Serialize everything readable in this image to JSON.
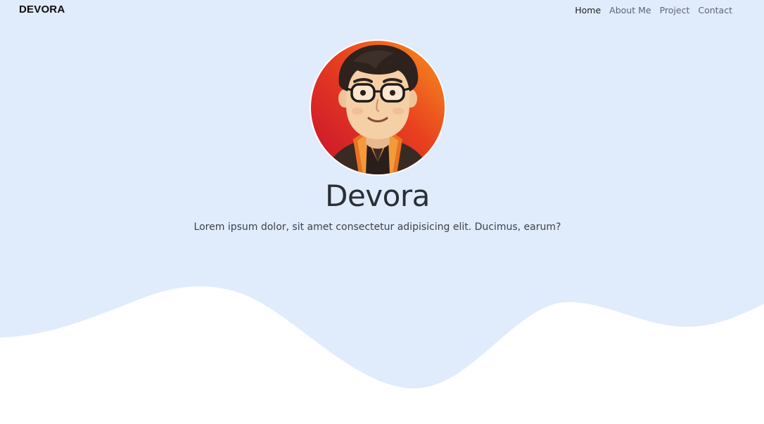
{
  "navbar": {
    "brand": "DEVORA",
    "links": [
      {
        "label": "Home",
        "active": true
      },
      {
        "label": "About Me",
        "active": false
      },
      {
        "label": "Project",
        "active": false
      },
      {
        "label": "Contact",
        "active": false
      }
    ]
  },
  "hero": {
    "title": "Devora",
    "subtitle": "Lorem ipsum dolor, sit amet consectetur adipisicing elit. Ducimus, earum?",
    "avatar_icon": "person-avatar"
  },
  "colors": {
    "hero_background": "#e0ebfc",
    "page_background": "#ffffff",
    "avatar_gradient_start": "#d11a3a",
    "avatar_gradient_end": "#f58a1f"
  }
}
